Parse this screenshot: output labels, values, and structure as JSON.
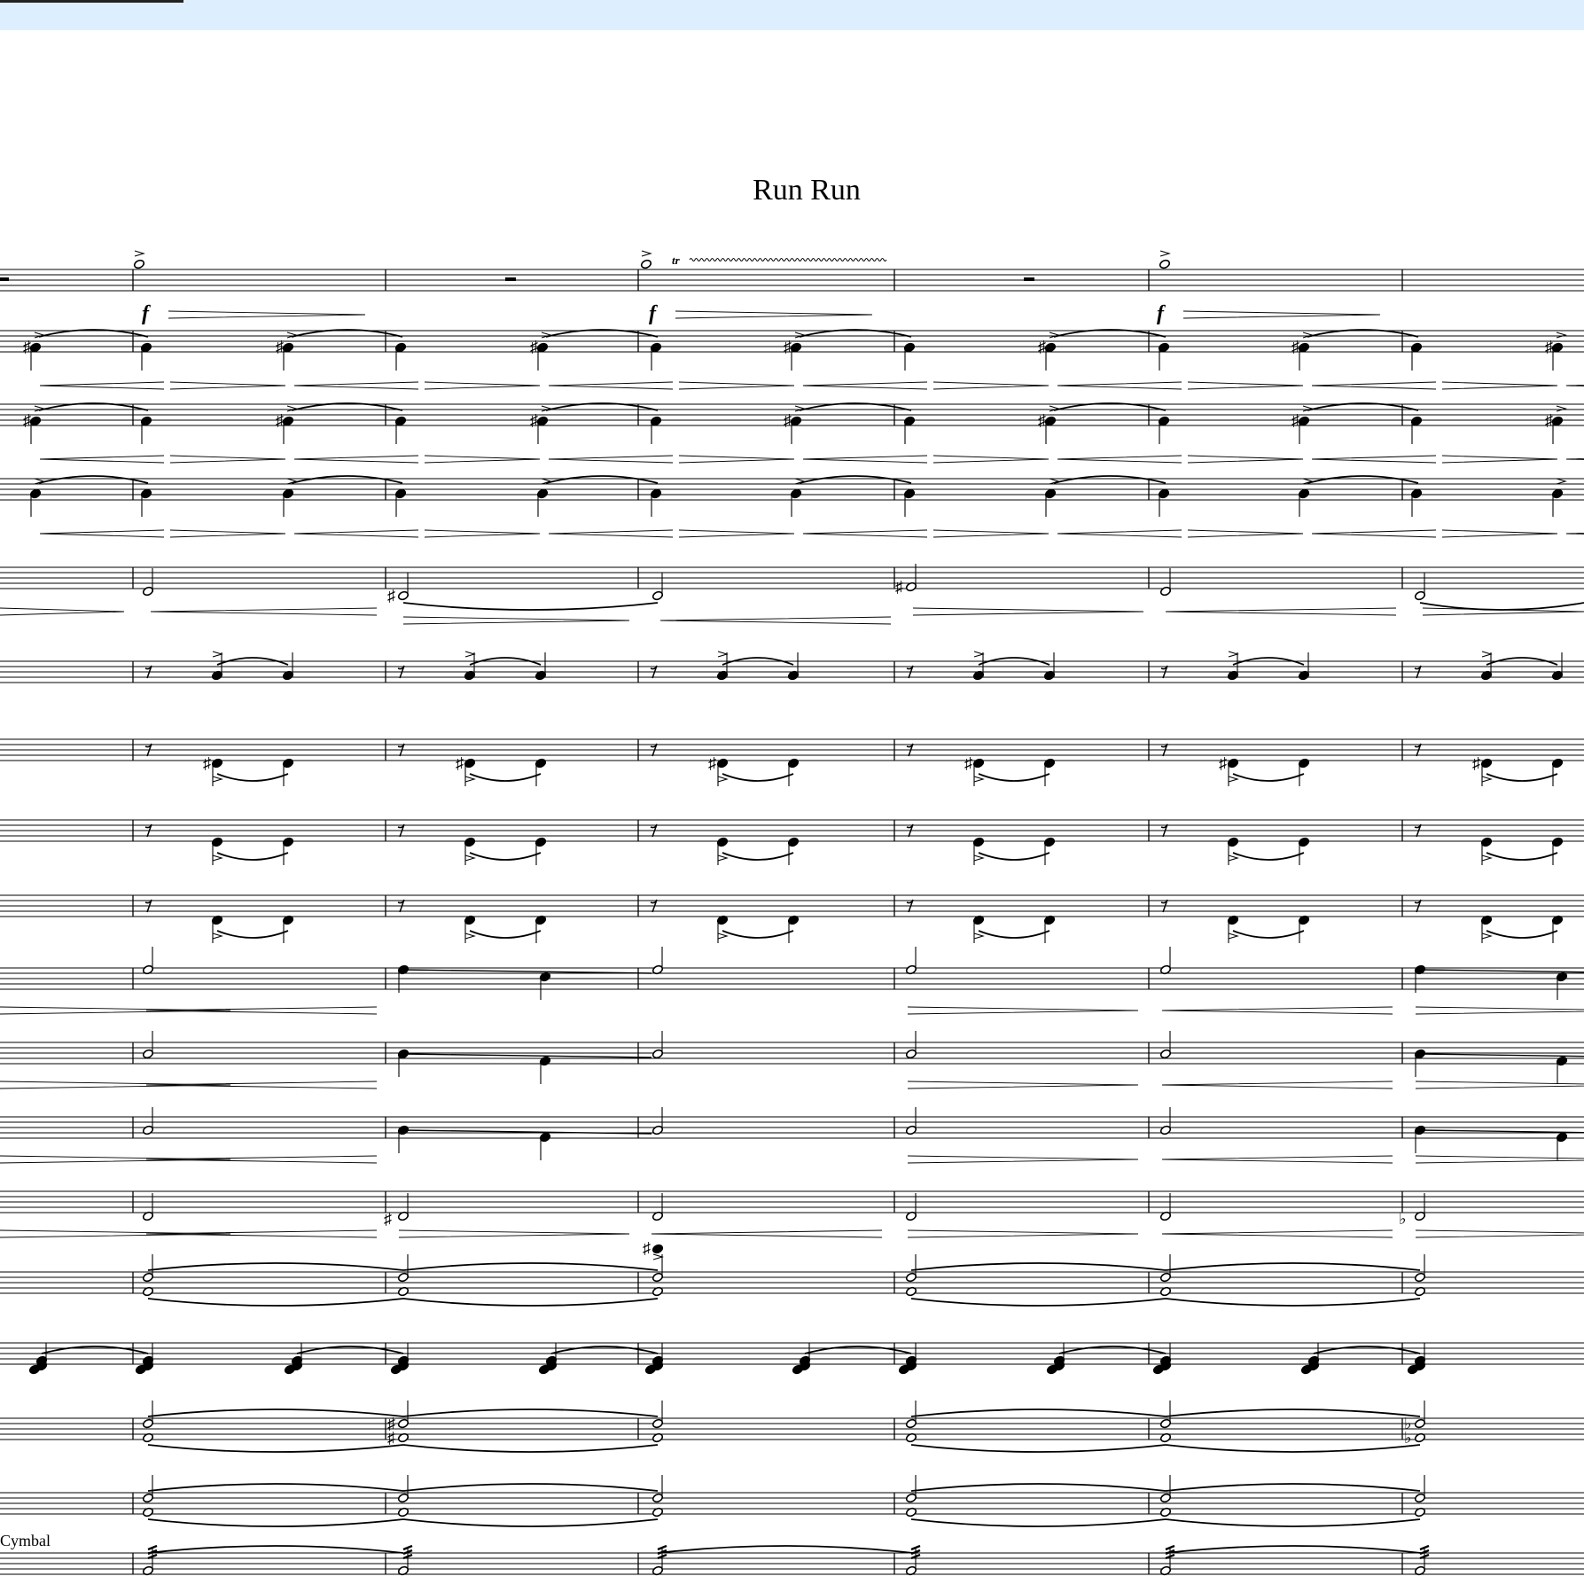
{
  "window": {
    "tab_indicator": ""
  },
  "score": {
    "title": "Run Run",
    "dynamic_mark": "f",
    "trill_mark": "tr",
    "instrument_label": "Cymbal",
    "accidental_sharp": "♯",
    "accidental_flat": "♭"
  },
  "colors": {
    "topbar": "#ddeeff",
    "ink": "#000000",
    "background": "#ffffff"
  }
}
